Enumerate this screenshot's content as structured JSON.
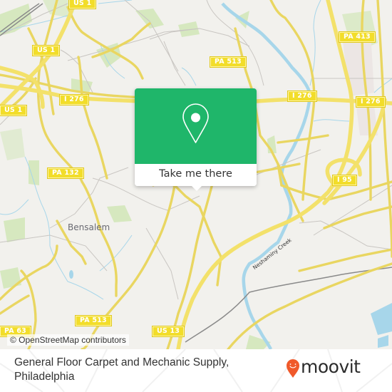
{
  "map": {
    "popup": {
      "button_label": "Take me there",
      "pin_icon": "map-pin-icon",
      "accent_color": "#1fb66a"
    },
    "place_labels": [
      {
        "id": "bensalem",
        "text": "Bensalem"
      }
    ],
    "water_labels": [
      {
        "id": "neshaminy-creek",
        "text": "Neshaminy Creek"
      }
    ],
    "road_shields": [
      {
        "id": "us1-top",
        "text": "US 1"
      },
      {
        "id": "us1-mid",
        "text": "US 1"
      },
      {
        "id": "us1-left",
        "text": "US 1"
      },
      {
        "id": "i276-left",
        "text": "I 276"
      },
      {
        "id": "pa513-top",
        "text": "PA 513"
      },
      {
        "id": "pa413",
        "text": "PA 413"
      },
      {
        "id": "i276-mid",
        "text": "I 276"
      },
      {
        "id": "i276-right",
        "text": "I 276"
      },
      {
        "id": "pa132",
        "text": "PA 132"
      },
      {
        "id": "i95",
        "text": "I 95"
      },
      {
        "id": "pa513-bottom",
        "text": "PA 513"
      },
      {
        "id": "pa63",
        "text": "PA 63"
      },
      {
        "id": "us13",
        "text": "US 13"
      }
    ],
    "attribution": "© OpenStreetMap contributors"
  },
  "footer": {
    "place_name": "General Floor Carpet and Mechanic Supply, Philadelphia",
    "brand": "moovit",
    "brand_color": "#f0592a"
  }
}
